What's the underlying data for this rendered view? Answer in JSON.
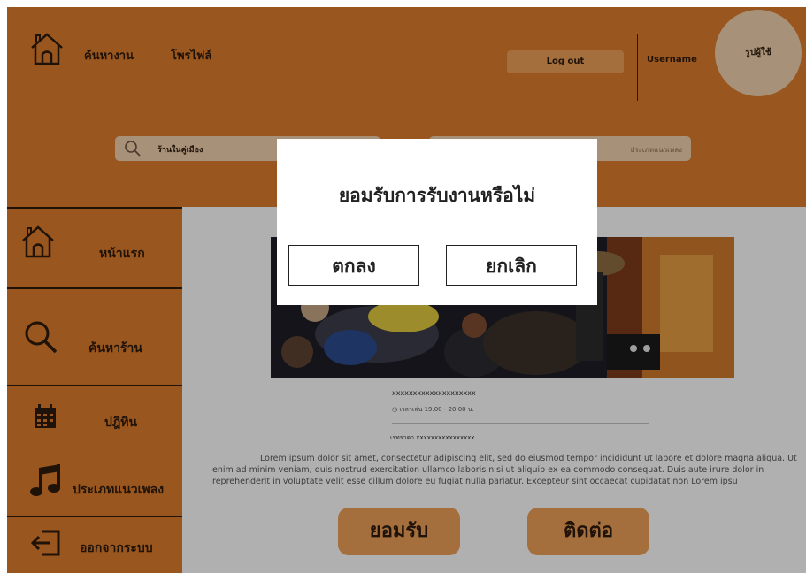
{
  "header": {
    "nav_find_jobs": "ค้นหางาน",
    "nav_profile": "โพรไฟล์",
    "logout_label": "Log out",
    "username": "Username",
    "avatar_label": "รูปผู้ใช้"
  },
  "search": {
    "left_value": "ร้านในคู่เมือง",
    "right_placeholder": "ประเภทแนวเพลง"
  },
  "sidebar": {
    "items": [
      {
        "label": "หน้าแรก",
        "icon": "home-icon"
      },
      {
        "label": "ค้นหาร้าน",
        "icon": "search-icon"
      },
      {
        "label": "ปฎิทิน",
        "icon": "calendar-icon"
      },
      {
        "label": "ประเภทแนวเพลง",
        "icon": "music-note-icon"
      },
      {
        "label": "ออกจากระบบ",
        "icon": "logout-icon"
      }
    ]
  },
  "job": {
    "title": "xxxxxxxxxxxxxxxxxxxx",
    "time": "เวลาเล่น 19.00 - 20.00 น.",
    "price": "เรทราคา xxxxxxxxxxxxxxxx",
    "description": "Lorem ipsum dolor sit amet, consectetur adipiscing elit, sed do eiusmod tempor incididunt ut labore et dolore magna aliqua. Ut enim ad minim veniam, quis nostrud exercitation ullamco laboris nisi ut aliquip ex ea commodo consequat. Duis aute irure dolor in reprehenderit in voluptate velit esse cillum dolore eu fugiat nulla pariatur. Excepteur sint occaecat cupidatat non Lorem ipsu",
    "accept_label": "ยอมรับ",
    "contact_label": "ติดต่อ"
  },
  "modal": {
    "title": "ยอมรับการรับงานหรือไม่",
    "ok_label": "ตกลง",
    "cancel_label": "ยกเลิก"
  },
  "colors": {
    "brand": "#d4782a",
    "button": "#e59a55",
    "light": "#e8c9a8"
  }
}
